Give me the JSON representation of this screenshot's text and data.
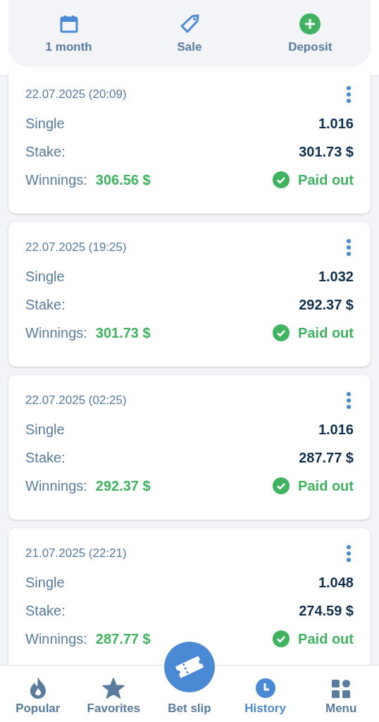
{
  "filters": [
    {
      "kind": "calendar",
      "label": "1 month"
    },
    {
      "kind": "tag",
      "label": "Sale"
    },
    {
      "kind": "deposit",
      "label": "Deposit"
    }
  ],
  "bets": [
    {
      "date": "22.07.2025 (20:09)",
      "type": "Single",
      "odds": "1.016",
      "stake_label": "Stake:",
      "stake": "301.73 $",
      "winnings_label": "Winnings:",
      "winnings": "306.56 $",
      "status": "Paid out"
    },
    {
      "date": "22.07.2025 (19:25)",
      "type": "Single",
      "odds": "1.032",
      "stake_label": "Stake:",
      "stake": "292.37 $",
      "winnings_label": "Winnings:",
      "winnings": "301.73 $",
      "status": "Paid out"
    },
    {
      "date": "22.07.2025 (02:25)",
      "type": "Single",
      "odds": "1.016",
      "stake_label": "Stake:",
      "stake": "287.77 $",
      "winnings_label": "Winnings:",
      "winnings": "292.37 $",
      "status": "Paid out"
    },
    {
      "date": "21.07.2025 (22:21)",
      "type": "Single",
      "odds": "1.048",
      "stake_label": "Stake:",
      "stake": "274.59 $",
      "winnings_label": "Winnings:",
      "winnings": "287.77 $",
      "status": "Paid out"
    }
  ],
  "nav": [
    {
      "kind": "fire",
      "label": "Popular",
      "selected": false
    },
    {
      "kind": "star",
      "label": "Favorites",
      "selected": false
    },
    {
      "kind": "ticket",
      "label": "Bet slip",
      "selected": false
    },
    {
      "kind": "clock",
      "label": "History",
      "selected": true
    },
    {
      "kind": "grid",
      "label": "Menu",
      "selected": false
    }
  ]
}
